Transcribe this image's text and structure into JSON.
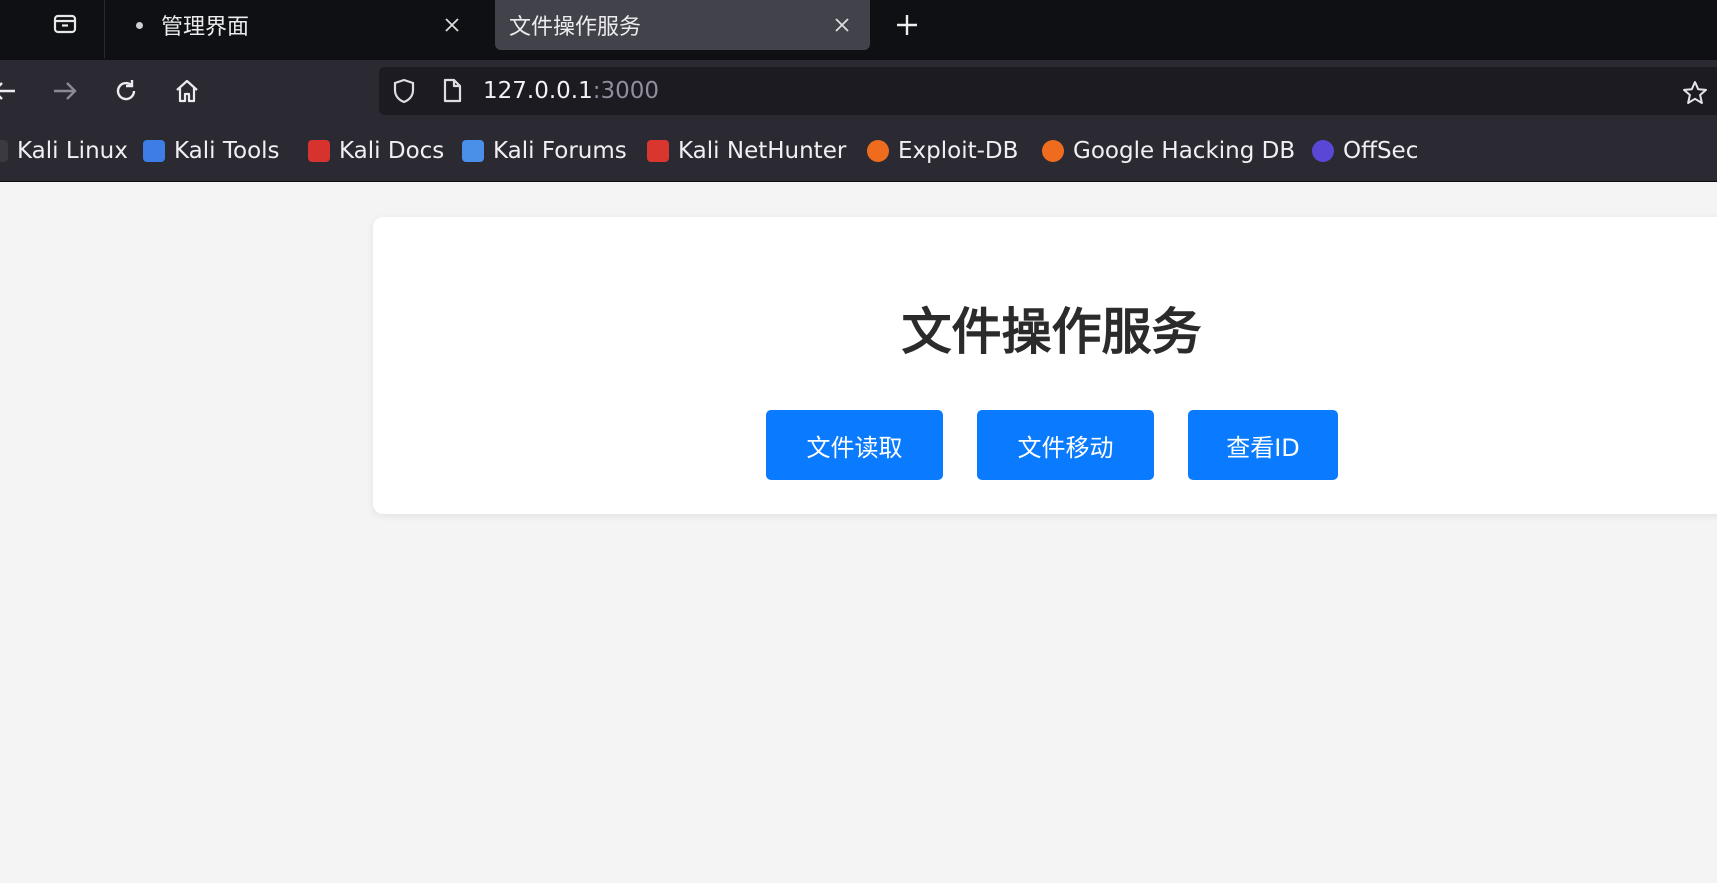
{
  "tabs": [
    {
      "title": "管理界面",
      "active": false
    },
    {
      "title": "文件操作服务",
      "active": true
    }
  ],
  "address": {
    "host": "127.0.0.1",
    "port": ":3000"
  },
  "bookmarks": [
    {
      "label": "Kali Linux",
      "icon": "kali-dragon-icon"
    },
    {
      "label": "Kali Tools",
      "icon": "kali-tools-icon"
    },
    {
      "label": "Kali Docs",
      "icon": "kali-docs-icon"
    },
    {
      "label": "Kali Forums",
      "icon": "kali-forums-icon"
    },
    {
      "label": "Kali NetHunter",
      "icon": "kali-nethunter-icon"
    },
    {
      "label": "Exploit-DB",
      "icon": "exploit-db-icon"
    },
    {
      "label": "Google Hacking DB",
      "icon": "ghdb-icon"
    },
    {
      "label": "OffSec",
      "icon": "offsec-icon"
    }
  ],
  "page": {
    "title": "文件操作服务",
    "buttons": [
      {
        "label": "文件读取"
      },
      {
        "label": "文件移动"
      },
      {
        "label": "查看ID"
      }
    ],
    "accent_color": "#0a7bff",
    "background_color": "#f4f4f4"
  }
}
